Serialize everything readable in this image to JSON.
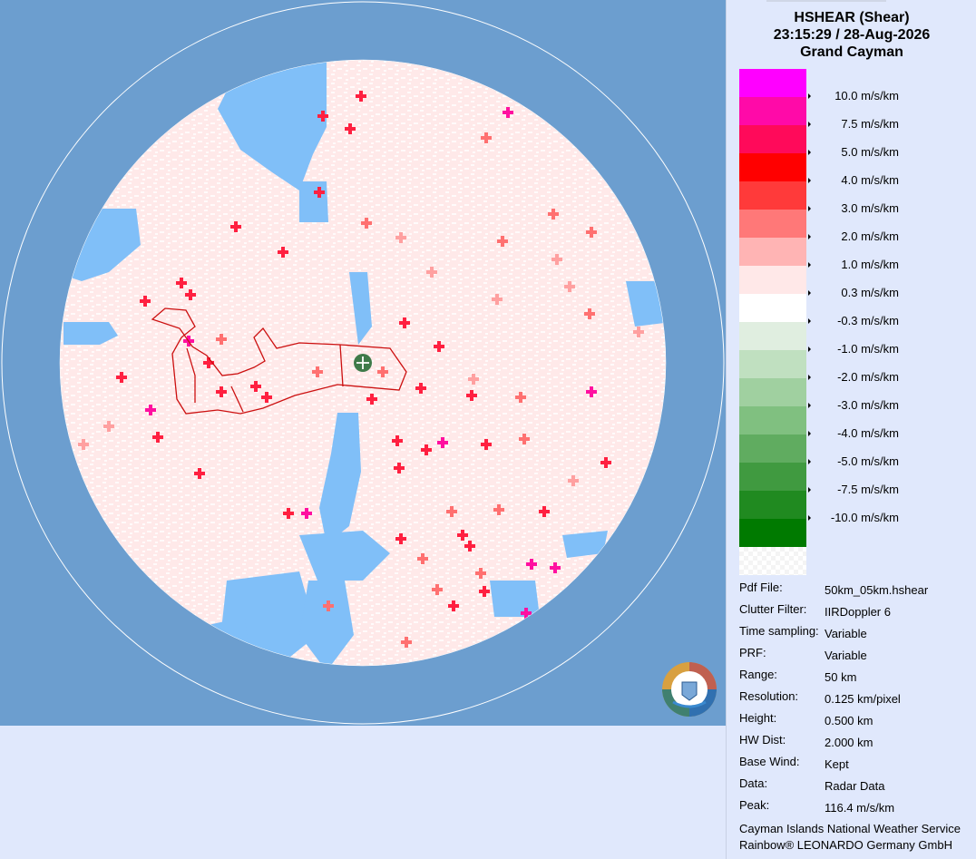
{
  "header": {
    "product": "HSHEAR (Shear)",
    "datetime": "23:15:29 / 28-Aug-2026",
    "site": "Grand Cayman"
  },
  "legend": {
    "items": [
      {
        "color": "#ff00ff",
        "label": "10.0 m/s/km"
      },
      {
        "color": "#ff0aa8",
        "label": "7.5 m/s/km"
      },
      {
        "color": "#ff0a5a",
        "label": "5.0 m/s/km"
      },
      {
        "color": "#ff0000",
        "label": "4.0 m/s/km"
      },
      {
        "color": "#ff3a3a",
        "label": "3.0 m/s/km"
      },
      {
        "color": "#ff7878",
        "label": "2.0 m/s/km"
      },
      {
        "color": "#ffb4b4",
        "label": "1.0 m/s/km"
      },
      {
        "color": "#ffe8e8",
        "label": "0.3 m/s/km"
      },
      {
        "color": "#ffffff",
        "label": "-0.3 m/s/km"
      },
      {
        "color": "#e0eee0",
        "label": "-1.0 m/s/km"
      },
      {
        "color": "#c0e0c0",
        "label": "-2.0 m/s/km"
      },
      {
        "color": "#a0d0a0",
        "label": "-3.0 m/s/km"
      },
      {
        "color": "#80c080",
        "label": "-4.0 m/s/km"
      },
      {
        "color": "#60ac60",
        "label": "-5.0 m/s/km"
      },
      {
        "color": "#409a40",
        "label": "-7.5 m/s/km"
      },
      {
        "color": "#208a20",
        "label": "-10.0 m/s/km"
      },
      {
        "color": "#007a00",
        "label": ""
      }
    ],
    "nodata_label": ""
  },
  "info": {
    "rows": [
      {
        "key": "Pdf File:",
        "value": "50km_05km.hshear"
      },
      {
        "key": "Clutter Filter:",
        "value": "IIRDoppler 6"
      },
      {
        "key": "Time sampling:",
        "value": "Variable"
      },
      {
        "key": "PRF:",
        "value": "Variable"
      },
      {
        "key": "Range:",
        "value": "50 km"
      },
      {
        "key": "Resolution:",
        "value": "0.125 km/pixel"
      },
      {
        "key": "Height:",
        "value": "0.500 km"
      },
      {
        "key": "HW Dist:",
        "value": "2.000 km"
      },
      {
        "key": "Base Wind:",
        "value": "Kept"
      },
      {
        "key": "Data:",
        "value": "Radar Data"
      },
      {
        "key": "Peak:",
        "value": "116.4 m/s/km"
      }
    ]
  },
  "credits": {
    "line1": "Cayman Islands National Weather Service",
    "line2": "Rainbow® LEONARDO Germany GmbH"
  },
  "colors": {
    "outside_range": "#6c9ecf",
    "no_echo_blue": "#80bff8",
    "coastline": "#cc1010",
    "radar_marker": "#3f7a4a",
    "panel_bg": "#e0e8fc"
  }
}
